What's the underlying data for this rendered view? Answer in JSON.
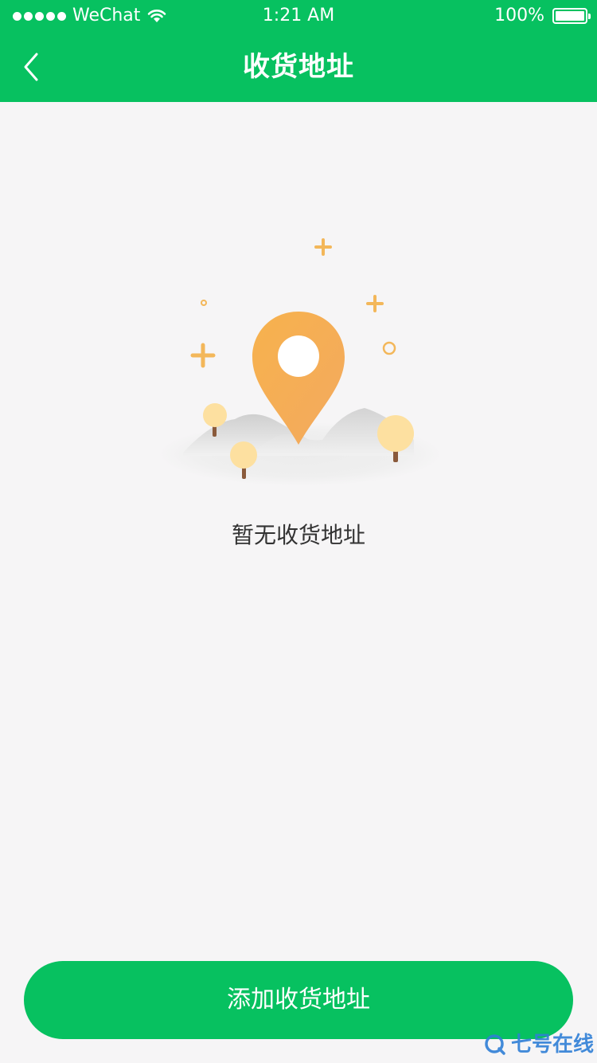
{
  "status_bar": {
    "carrier": "WeChat",
    "time": "1:21 AM",
    "battery": "100%",
    "signal_icon": "signal-dots-icon",
    "wifi_icon": "wifi-icon",
    "battery_icon": "battery-icon"
  },
  "nav": {
    "title": "收货地址",
    "back_icon": "chevron-left-icon"
  },
  "empty_state": {
    "illustration_icon": "location-pin-icon",
    "message": "暂无收货地址"
  },
  "footer": {
    "add_label": "添加收货地址"
  },
  "watermark": {
    "text": "七号在线"
  },
  "colors": {
    "brand_green": "#07c160",
    "background": "#f6f5f6",
    "pin_orange": "#f5ac55",
    "tree_yellow": "#fde0a0",
    "text_dark": "#333333",
    "watermark_blue": "#2f7fd6"
  }
}
